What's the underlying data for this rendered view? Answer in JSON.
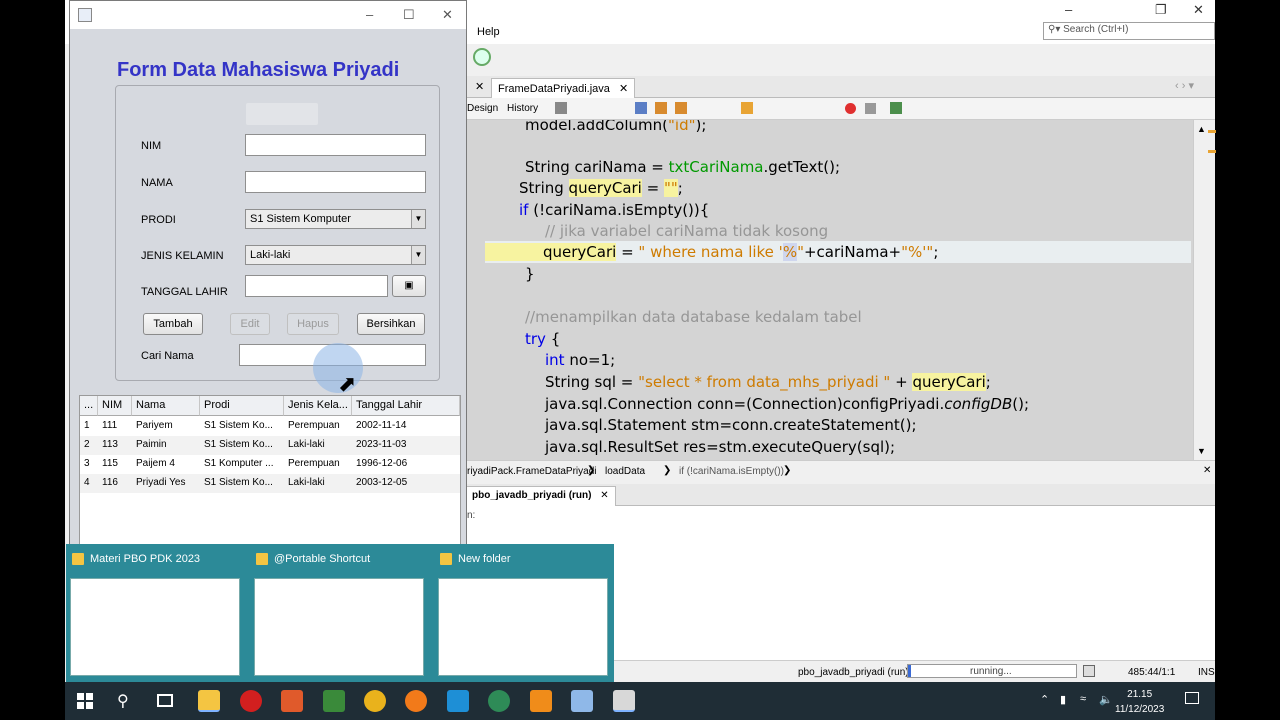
{
  "ide": {
    "menu_help": "Help",
    "search_placeholder": "Search (Ctrl+I)",
    "tab_label": "FrameDataPriyadi.java",
    "design_tab": "Design",
    "history_tab": "History",
    "code_lines": [
      {
        "text": "model.addColumn(\"id\");"
      },
      {
        "text": "String cariNama = txtCariNama.getText();"
      },
      {
        "text": "String queryCari = \"\";"
      },
      {
        "text": "if (!cariNama.isEmpty()){"
      },
      {
        "text": "// jika variabel cariNama tidak kosong"
      },
      {
        "text": "queryCari = \" where nama like '%\"+cariNama+\"%'\";"
      },
      {
        "text": "}"
      },
      {
        "text": "//menampilkan data database kedalam tabel"
      },
      {
        "text": "try {"
      },
      {
        "text": "int no=1;"
      },
      {
        "text": "String sql = \"select * from data_mhs_priyadi \" + queryCari;"
      },
      {
        "text": "java.sql.Connection conn=(Connection)configPriyadi.configDB();"
      },
      {
        "text": "java.sql.Statement stm=conn.createStatement();"
      },
      {
        "text": "java.sql.ResultSet res=stm.executeQuery(sql);"
      }
    ],
    "breadcrumb": [
      "riyadiPack.FrameDataPriyadi",
      "loadData",
      "if (!cariNama.isEmpty())"
    ],
    "output_tab": "pbo_javadb_priyadi (run)",
    "output_text": "n:",
    "status_project": "pbo_javadb_priyadi (run)",
    "status_running": "running...",
    "status_position": "485:44/1:1",
    "status_mode": "INS"
  },
  "form": {
    "title": "Form Data Mahasiswa Priyadi",
    "labels": {
      "nim": "NIM",
      "nama": "NAMA",
      "prodi": "PRODI",
      "jenis_kelamin": "JENIS KELAMIN",
      "tanggal_lahir": "TANGGAL LAHIR",
      "cari_nama": "Cari Nama"
    },
    "prodi_selected": "S1 Sistem Komputer",
    "jenis_kelamin_selected": "Laki-laki",
    "buttons": {
      "tambah": "Tambah",
      "edit": "Edit",
      "hapus": "Hapus",
      "bersihkan": "Bersihkan"
    },
    "table": {
      "columns": [
        "...",
        "NIM",
        "Nama",
        "Prodi",
        "Jenis Kela...",
        "Tanggal Lahir"
      ],
      "rows": [
        [
          "1",
          "111",
          "Pariyem",
          "S1 Sistem Ko...",
          "Perempuan",
          "2002-11-14"
        ],
        [
          "2",
          "113",
          "Paimin",
          "S1 Sistem Ko...",
          "Laki-laki",
          "2023-11-03"
        ],
        [
          "3",
          "115",
          "Paijem 4",
          "S1 Komputer ...",
          "Perempuan",
          "1996-12-06"
        ],
        [
          "4",
          "116",
          "Priyadi Yes",
          "S1 Sistem Ko...",
          "Laki-laki",
          "2003-12-05"
        ]
      ]
    }
  },
  "taskbar_preview": [
    {
      "title": "Materi PBO PDK 2023"
    },
    {
      "title": "@Portable Shortcut"
    },
    {
      "title": "New folder"
    }
  ],
  "tray": {
    "time": "21.15",
    "date": "11/12/2023"
  }
}
